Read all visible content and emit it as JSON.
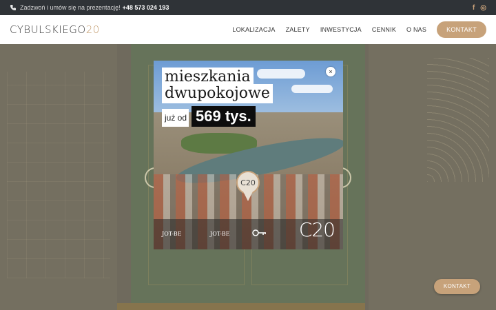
{
  "topbar": {
    "call_text": "Zadzwoń i umów się na prezentację!",
    "phone_number": "+48 573 024 193",
    "social": {
      "facebook": "f",
      "instagram": "◎"
    }
  },
  "header": {
    "logo_text": "CYBULSKIEGO",
    "logo_number": "20",
    "nav": [
      "LOKALIZACJA",
      "ZALETY",
      "INWESTYCJA",
      "CENNIK",
      "O NAS"
    ],
    "cta": "KONTAKT"
  },
  "modal": {
    "headline_line1": "mieszkania",
    "headline_line2": "dwupokojowe",
    "price_prefix": "już od",
    "price": "569 tys.",
    "pin_label": "C20",
    "brand1": "JOT-BE",
    "brand2": "JOT-BE",
    "logo": "C20",
    "close_label": "×"
  },
  "floating_cta": "KONTAKT",
  "colors": {
    "accent": "#c7a27a",
    "topbar": "#2f3337"
  }
}
